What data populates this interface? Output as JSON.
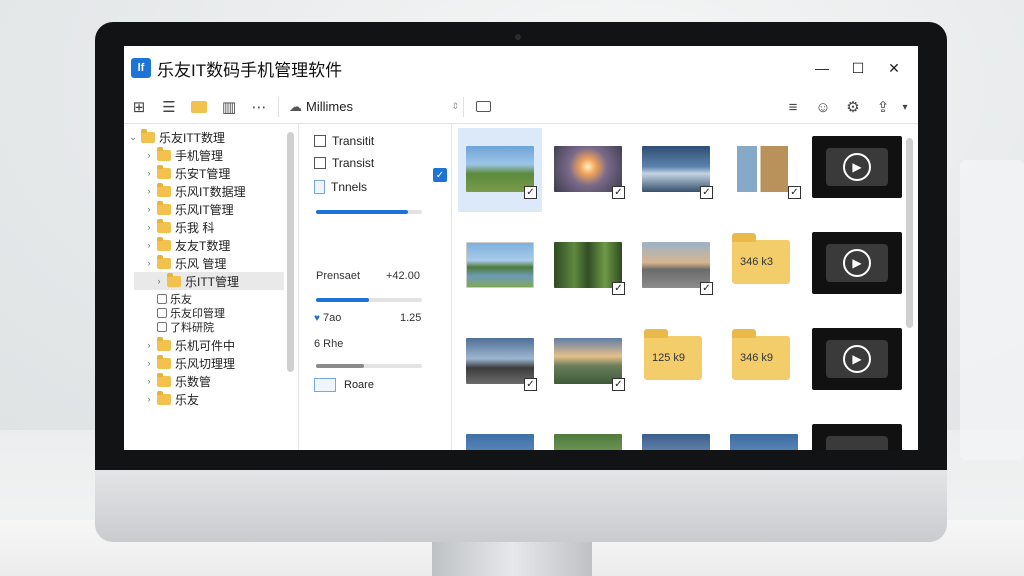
{
  "app": {
    "title": "乐友IT数码手机管理软件",
    "logo": "lf"
  },
  "window": {
    "minimize": "—",
    "maximize": "☐",
    "close": "✕"
  },
  "toolbar": {
    "path": "Millimes",
    "left_icons": [
      "filter-icon",
      "sort-icon",
      "folder-icon",
      "columns-icon",
      "more-icon"
    ],
    "right_icons": [
      "list-icon",
      "user-icon",
      "settings-icon",
      "share-icon"
    ]
  },
  "tree": {
    "items": [
      {
        "label": "乐友ITT数理",
        "level": 0,
        "expanded": true
      },
      {
        "label": "手机管理",
        "level": 1
      },
      {
        "label": "乐安T管理",
        "level": 1
      },
      {
        "label": "乐风IT数据理",
        "level": 1
      },
      {
        "label": "乐风IT管理",
        "level": 1
      },
      {
        "label": "乐我 科",
        "level": 1
      },
      {
        "label": "友友T数理",
        "level": 1
      },
      {
        "label": "乐风 管理",
        "level": 1
      },
      {
        "label": "乐ITT管理",
        "level": 2,
        "selected": true
      },
      {
        "label": "乐友",
        "level": 3
      },
      {
        "label": "乐友印管理",
        "level": 3
      },
      {
        "label": "了料研院",
        "level": 3
      },
      {
        "label": "乐机可件中",
        "level": 1
      },
      {
        "label": "乐风切理理",
        "level": 1
      },
      {
        "label": "乐数管",
        "level": 1
      },
      {
        "label": "乐友",
        "level": 1
      }
    ]
  },
  "panel": {
    "check1": "Transitit",
    "check2": "Transist",
    "doc": "Tnnels",
    "label_a": "Prensaet",
    "value_a": "+42.00",
    "label_b": "7ao",
    "value_b": "1.25",
    "label_c": "6 Rhe",
    "bottom": "Roare",
    "bar1": 0.87,
    "bar2": 0.5,
    "bar3": 0.45
  },
  "grid": {
    "folder_labels": [
      "346 k3",
      "125 k9",
      "346 k9"
    ]
  }
}
